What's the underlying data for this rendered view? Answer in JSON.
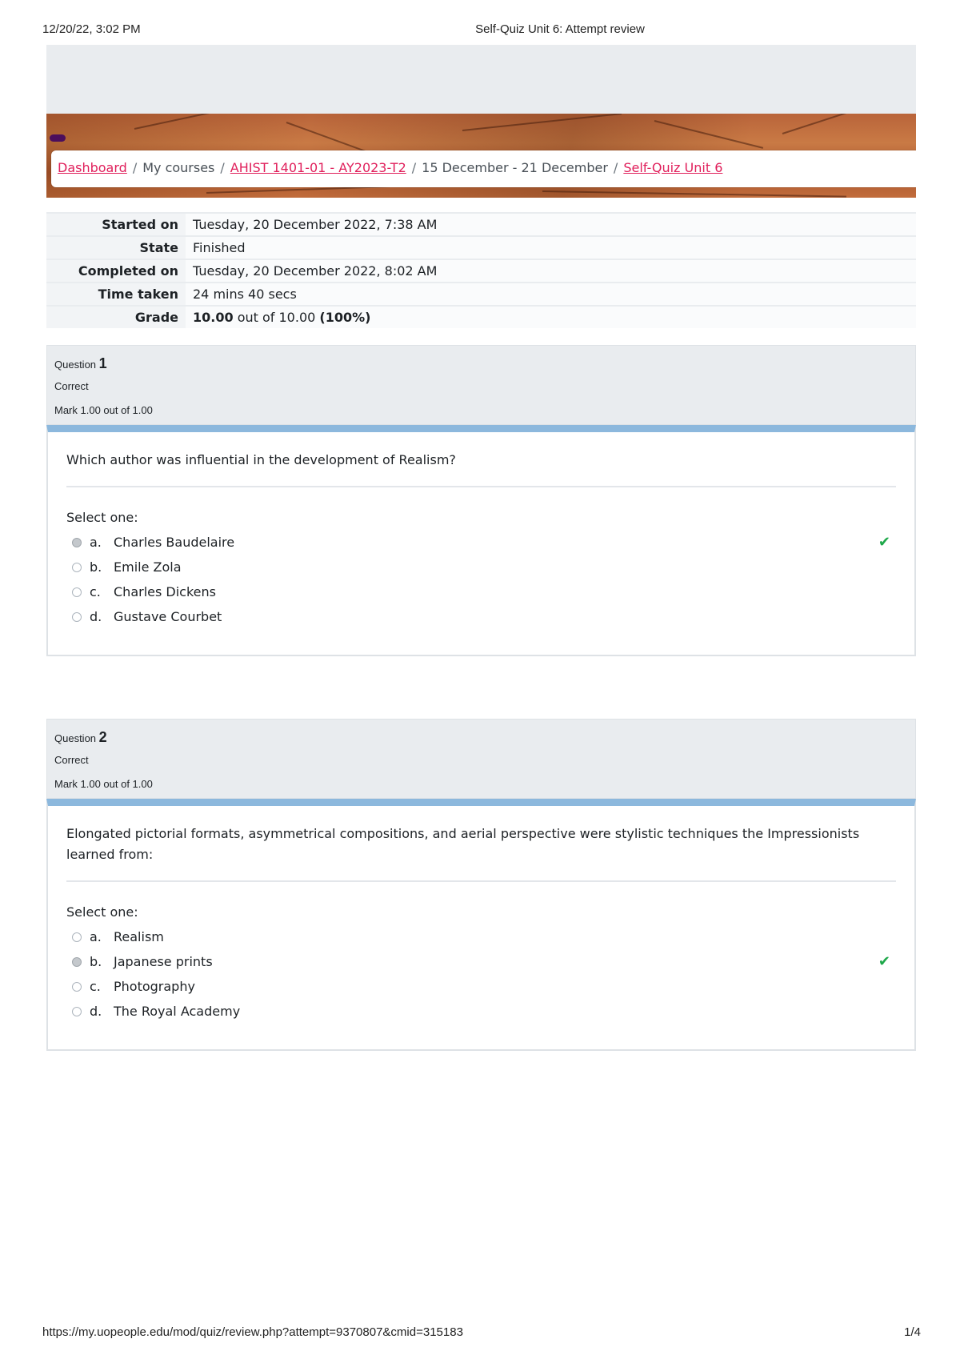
{
  "print_header": {
    "datetime": "12/20/22, 3:02 PM",
    "title": "Self-Quiz Unit 6: Attempt review"
  },
  "print_footer": {
    "url": "https://my.uopeople.edu/mod/quiz/review.php?attempt=9370807&cmid=315183",
    "page": "1/4"
  },
  "breadcrumb": {
    "dashboard": "Dashboard",
    "my_courses": "My courses",
    "course": "AHIST 1401-01 - AY2023-T2",
    "week": "15 December - 21 December",
    "quiz": "Self-Quiz Unit 6",
    "separator": "/"
  },
  "summary": {
    "started_label": "Started on",
    "started_value": "Tuesday, 20 December 2022, 7:38 AM",
    "state_label": "State",
    "state_value": "Finished",
    "completed_label": "Completed on",
    "completed_value": "Tuesday, 20 December 2022, 8:02 AM",
    "time_label": "Time taken",
    "time_value": "24 mins 40 secs",
    "grade_label": "Grade",
    "grade_score": "10.00",
    "grade_rest": " out of 10.00 ",
    "grade_pct": "(100%)"
  },
  "questions": [
    {
      "label": "Question",
      "number": "1",
      "state": "Correct",
      "mark": "Mark 1.00 out of 1.00",
      "text": "Which author was influential in the development of Realism?",
      "prompt": "Select one:",
      "answers": [
        {
          "letter": "a.",
          "text": "Charles Baudelaire"
        },
        {
          "letter": "b.",
          "text": "Emile Zola"
        },
        {
          "letter": "c.",
          "text": "Charles Dickens"
        },
        {
          "letter": "d.",
          "text": "Gustave Courbet"
        }
      ],
      "selected": "a",
      "correct_icon": "✔"
    },
    {
      "label": "Question",
      "number": "2",
      "state": "Correct",
      "mark": "Mark 1.00 out of 1.00",
      "text": "Elongated pictorial formats, asymmetrical compositions, and aerial perspective were stylistic techniques the Impressionists learned from:",
      "prompt": "Select one:",
      "answers": [
        {
          "letter": "a.",
          "text": "Realism"
        },
        {
          "letter": "b.",
          "text": "Japanese prints"
        },
        {
          "letter": "c.",
          "text": "Photography"
        },
        {
          "letter": "d.",
          "text": "The Royal Academy"
        }
      ],
      "selected": "b",
      "correct_icon": "✔"
    }
  ],
  "colors": {
    "link": "#e01f5b",
    "correct": "#1ea84a",
    "question_bar": "#8cb8dd",
    "info_bg": "#e9ecef"
  }
}
